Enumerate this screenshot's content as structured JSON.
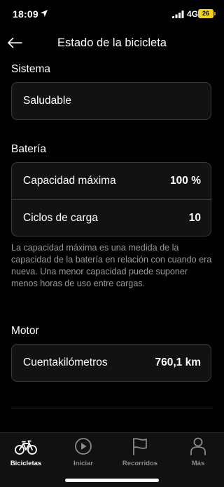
{
  "status_bar": {
    "time": "18:09",
    "network": "4G",
    "battery": "26"
  },
  "header": {
    "title": "Estado de la bicicleta"
  },
  "system": {
    "title": "Sistema",
    "status": "Saludable"
  },
  "battery": {
    "title": "Batería",
    "rows": [
      {
        "label": "Capacidad máxima",
        "value": "100 %"
      },
      {
        "label": "Ciclos de carga",
        "value": "10"
      }
    ],
    "note": "La capacidad máxima es una medida de la capacidad de la batería en relación con cuando era nueva. Una menor capacidad puede suponer menos horas de uso entre cargas."
  },
  "motor": {
    "title": "Motor",
    "rows": [
      {
        "label": "Cuentakilómetros",
        "value": "760,1 km"
      }
    ]
  },
  "tab_bar": {
    "tabs": [
      {
        "label": "Bicicletas",
        "icon": "bicycle-icon",
        "active": true
      },
      {
        "label": "Iniciar",
        "icon": "play-icon",
        "active": false
      },
      {
        "label": "Recorridos",
        "icon": "flag-icon",
        "active": false
      },
      {
        "label": "Más",
        "icon": "person-icon",
        "active": false
      }
    ]
  },
  "colors": {
    "background": "#000000",
    "card": "#121212",
    "card_border": "#3a3a3a",
    "muted_text": "#9a9a9a",
    "battery_fill": "#f2d21a"
  }
}
